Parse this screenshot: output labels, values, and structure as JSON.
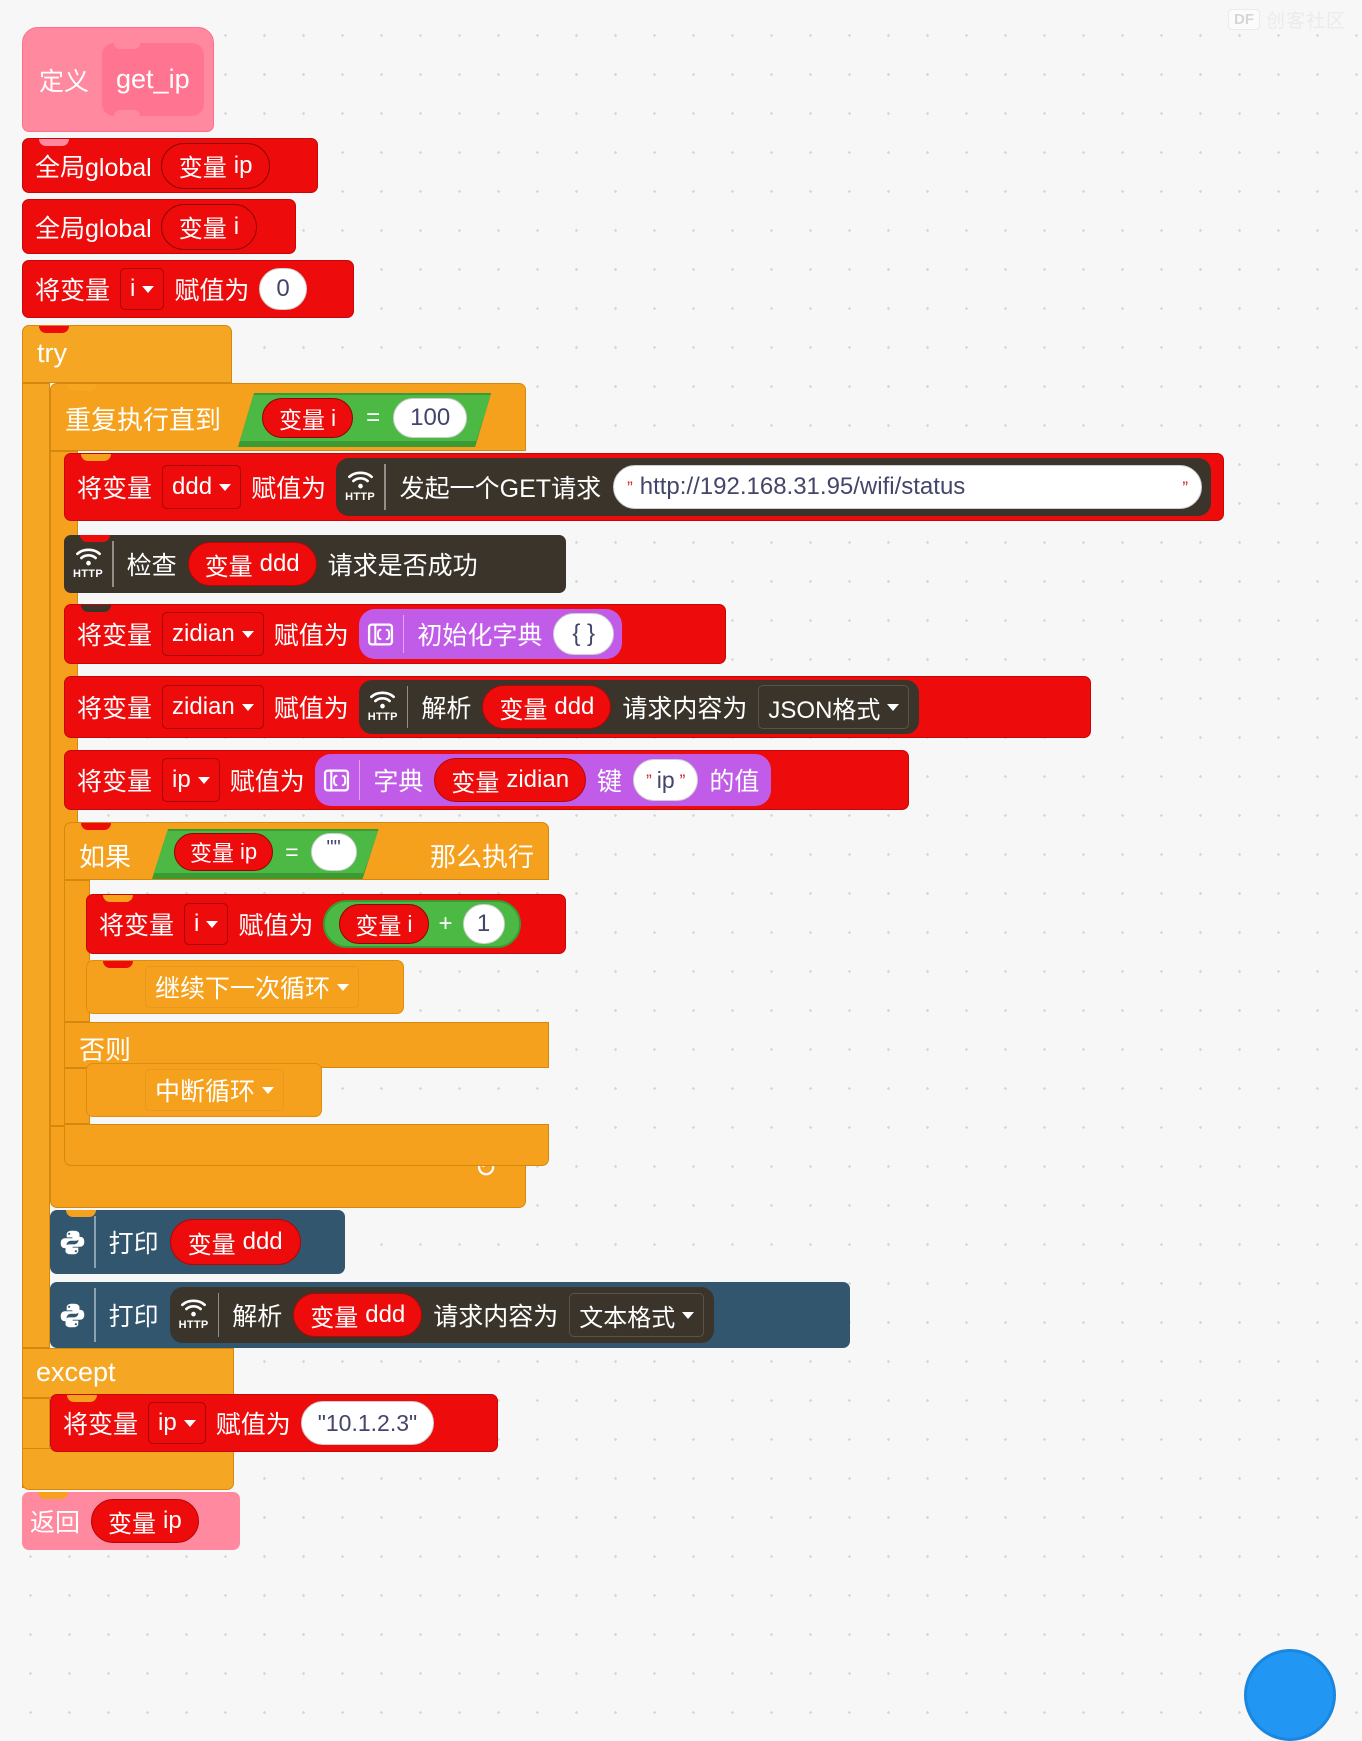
{
  "watermark": {
    "badge": "DF",
    "text": "创客社区"
  },
  "program": {
    "define": {
      "keyword": "定义",
      "name": "get_ip"
    },
    "global_ip": {
      "keyword": "全局global",
      "var_label": "变量",
      "var_name": "ip"
    },
    "global_i": {
      "keyword": "全局global",
      "var_label": "变量",
      "var_name": "i"
    },
    "set_i_zero": {
      "prefix": "将变量",
      "var": "i",
      "mid": "赋值为",
      "value": "0"
    },
    "try_label": "try",
    "repeat_until": {
      "label": "重复执行直到",
      "left_var_label": "变量",
      "left_var": "i",
      "operator": "=",
      "right_value": "100"
    },
    "set_ddd_get": {
      "prefix": "将变量",
      "var": "ddd",
      "mid": "赋值为",
      "icon": "http-wifi-icon",
      "action": "发起一个GET请求",
      "url": "http://192.168.31.95/wifi/status"
    },
    "check_request": {
      "icon": "http-wifi-icon",
      "prefix": "检查",
      "var_label": "变量",
      "var": "ddd",
      "suffix": "请求是否成功"
    },
    "set_zidian_init": {
      "prefix": "将变量",
      "var": "zidian",
      "mid": "赋值为",
      "icon": "dictionary-icon",
      "action": "初始化字典",
      "value": "{ }"
    },
    "set_zidian_json": {
      "prefix": "将变量",
      "var": "zidian",
      "mid": "赋值为",
      "icon": "http-wifi-icon",
      "action": "解析",
      "var_label": "变量",
      "src_var": "ddd",
      "suffix": "请求内容为",
      "format": "JSON格式"
    },
    "set_ip_from_dict": {
      "prefix": "将变量",
      "var": "ip",
      "mid": "赋值为",
      "icon": "dictionary-icon",
      "action": "字典",
      "var_label": "变量",
      "dict_var": "zidian",
      "key_label": "键",
      "key": "ip",
      "tail": "的值"
    },
    "if_block": {
      "if_label": "如果",
      "left_var_label": "变量",
      "left_var": "ip",
      "operator": "=",
      "right_value": "\"\"",
      "then_label": "那么执行",
      "else_label": "否则"
    },
    "increment_i": {
      "prefix": "将变量",
      "var": "i",
      "mid": "赋值为",
      "op_var_label": "变量",
      "op_var": "i",
      "operator": "+",
      "operand": "1"
    },
    "continue_loop": "继续下一次循环",
    "break_loop": "中断循环",
    "print_ddd": {
      "icon": "python-icon",
      "label": "打印",
      "var_label": "变量",
      "var": "ddd"
    },
    "print_parse_text": {
      "icon": "python-icon",
      "label": "打印",
      "http_icon": "http-wifi-icon",
      "action": "解析",
      "var_label": "变量",
      "var": "ddd",
      "suffix": "请求内容为",
      "format": "文本格式"
    },
    "except_label": "except",
    "set_ip_fallback": {
      "prefix": "将变量",
      "var": "ip",
      "mid": "赋值为",
      "value": "\"10.1.2.3\""
    },
    "return_block": {
      "label": "返回",
      "var_label": "变量",
      "var": "ip"
    }
  },
  "colors": {
    "red": "#ee0b0b",
    "orange": "#f5a623",
    "green": "#4cb944",
    "purple": "#c15ce8",
    "dark": "#3a342a",
    "navy": "#31566e",
    "pink": "#ff8aa0"
  }
}
